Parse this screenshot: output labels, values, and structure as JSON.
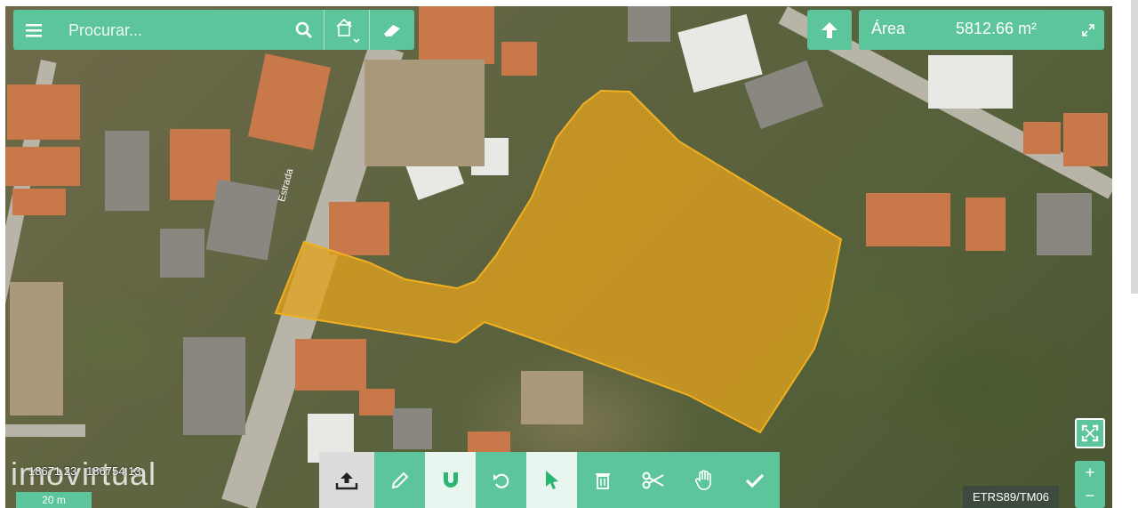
{
  "search": {
    "placeholder": "Procurar..."
  },
  "area": {
    "label": "Área",
    "value": "5812.66 m²"
  },
  "coordinates": {
    "x": "18671.23",
    "y": "186754.13"
  },
  "scale_label": "20 m",
  "crs_label": "ETRS89/TM06",
  "watermark": "imovirtual",
  "street_label": "Estrada",
  "colors": {
    "accent": "#5cc59b",
    "parcel_fill": "#e0a21e",
    "parcel_stroke": "#f0b020"
  },
  "icons": {
    "menu": "menu-icon",
    "search": "search-icon",
    "basemap": "basemap-icon",
    "eraser": "eraser-icon",
    "up": "arrow-up-icon",
    "expand": "expand-icon",
    "upload": "upload-icon",
    "edit": "pencil-icon",
    "snap": "magnet-icon",
    "undo": "undo-icon",
    "select": "cursor-icon",
    "delete": "trash-icon",
    "cut": "scissors-icon",
    "pan": "hand-icon",
    "confirm": "check-icon",
    "fullscreen": "fullscreen-icon"
  },
  "zoom": {
    "in": "+",
    "out": "−"
  }
}
